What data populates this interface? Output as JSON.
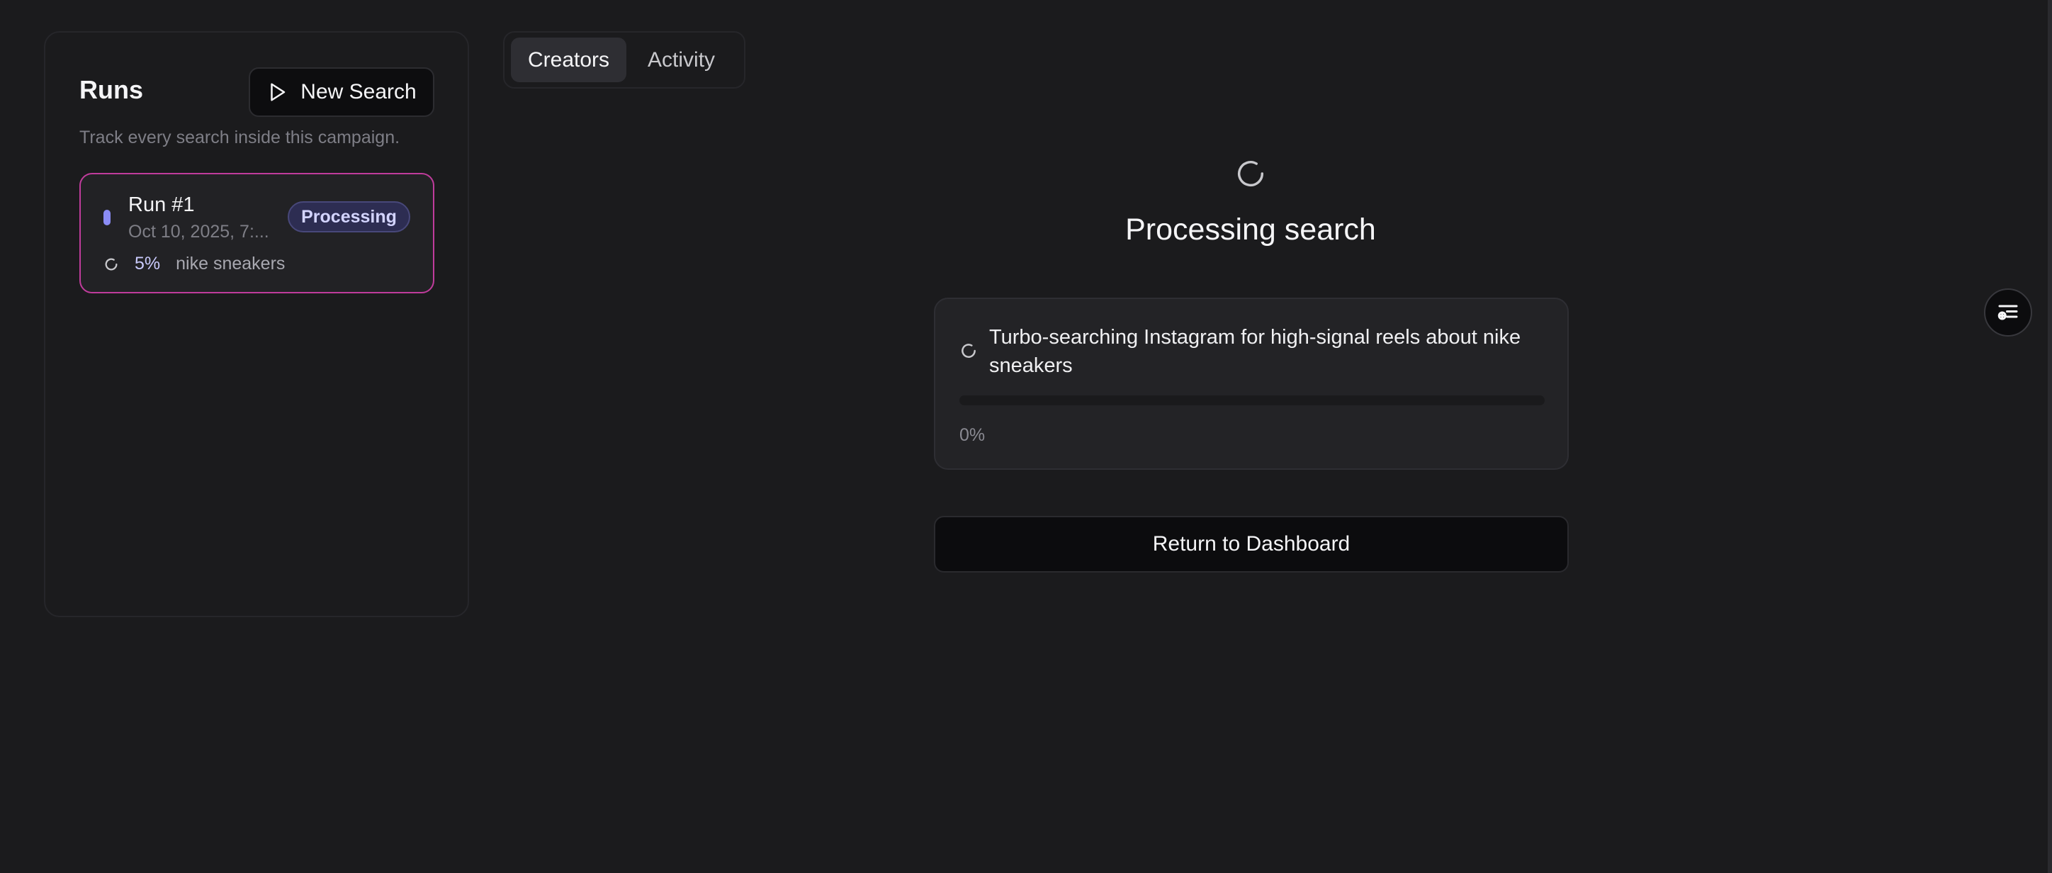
{
  "sidebar": {
    "title": "Runs",
    "new_search_label": "New Search",
    "subtitle": "Track every search inside this campaign.",
    "runs": [
      {
        "name": "Run #1",
        "date": "Oct 10, 2025, 7:...",
        "status": "Processing",
        "progress": "5%",
        "progress_value": 0.05,
        "query": "nike sneakers"
      }
    ]
  },
  "tabs": [
    {
      "label": "Creators",
      "active": true
    },
    {
      "label": "Activity",
      "active": false
    }
  ],
  "main": {
    "title": "Processing search",
    "status_message": "Turbo-searching Instagram for high-signal reels about nike sneakers",
    "progress_label": "0%",
    "progress_value": 0.0,
    "return_label": "Return to Dashboard"
  },
  "icons": {
    "new_search": "play-icon",
    "spinner": "loading-spinner-icon",
    "floating": "filter-list-icon"
  },
  "colors": {
    "background": "#1b1b1d",
    "accent": "#8b8cf5",
    "selected_border": "#c03c9c",
    "badge_bg": "#2d2d52"
  }
}
